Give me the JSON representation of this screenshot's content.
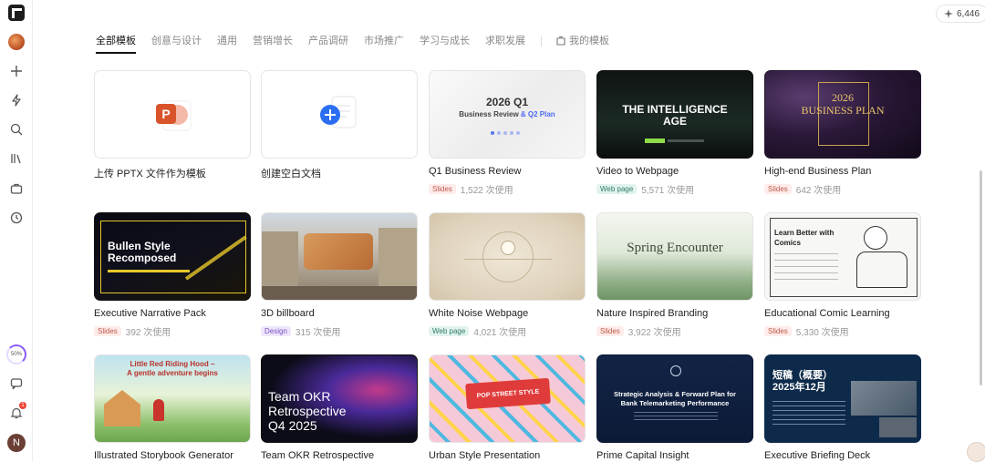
{
  "credits": "6,446",
  "rail": {
    "progress": "50%",
    "notifications": "1",
    "user_initial": "N"
  },
  "tabs": [
    "全部模板",
    "创意与设计",
    "通用",
    "营销增长",
    "产品调研",
    "市场推广",
    "学习与成长",
    "求职发展"
  ],
  "my_templates": "我的模板",
  "upload_card": {
    "title": "上传 PPTX 文件作为模板"
  },
  "blank_card": {
    "title": "创建空白文档"
  },
  "cards": [
    {
      "title": "Q1 Business Review",
      "tag": "Slides",
      "uses": "1,522 次使用",
      "thumb_text": [
        "2026 Q1",
        "Business Review",
        "& Q2 Plan"
      ]
    },
    {
      "title": "Video to Webpage",
      "tag": "Web page",
      "uses": "5,571 次使用",
      "thumb_text": [
        "THE INTELLIGENCE",
        "AGE"
      ]
    },
    {
      "title": "High-end Business Plan",
      "tag": "Slides",
      "uses": "642 次使用",
      "thumb_text": [
        "2026",
        "BUSINESS PLAN"
      ]
    },
    {
      "title": "Executive Narrative Pack",
      "tag": "Slides",
      "uses": "392 次使用",
      "thumb_text": [
        "Bullen Style",
        "Recomposed"
      ]
    },
    {
      "title": "3D billboard",
      "tag": "Design",
      "uses": "315 次使用"
    },
    {
      "title": "White Noise Webpage",
      "tag": "Web page",
      "uses": "4,021 次使用"
    },
    {
      "title": "Nature Inspired Branding",
      "tag": "Slides",
      "uses": "3,922 次使用",
      "thumb_text": [
        "Spring Encounter"
      ]
    },
    {
      "title": "Educational Comic Learning",
      "tag": "Slides",
      "uses": "5,330 次使用",
      "thumb_text": [
        "Learn Better with",
        "Comics"
      ]
    },
    {
      "title": "Illustrated Storybook Generator",
      "thumb_text": [
        "Little Red Riding Hood –",
        "A gentle adventure begins"
      ]
    },
    {
      "title": "Team OKR Retrospective",
      "thumb_text": [
        "Team OKR",
        "Retrospective",
        "Q4 2025"
      ]
    },
    {
      "title": "Urban Style Presentation",
      "thumb_text": [
        "POP STREET STYLE"
      ]
    },
    {
      "title": "Prime Capital Insight",
      "thumb_text": [
        "Strategic Analysis & Forward Plan for",
        "Bank Telemarketing Performance"
      ]
    },
    {
      "title": "Executive Briefing Deck",
      "thumb_text": [
        "短稿（概要）",
        "2025年12月"
      ]
    }
  ]
}
